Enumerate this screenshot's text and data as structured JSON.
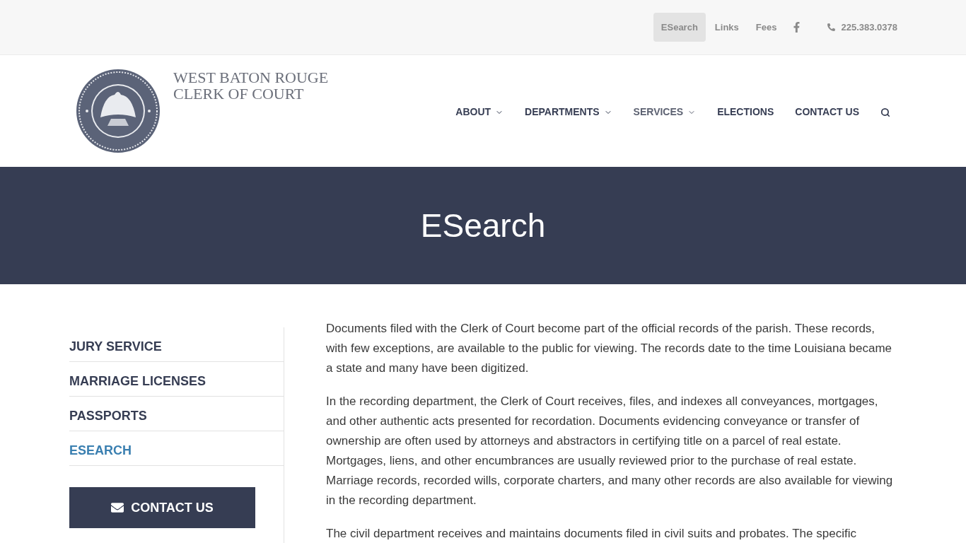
{
  "top_bar": {
    "links": [
      {
        "label": "ESearch",
        "selected": true
      },
      {
        "label": "Links",
        "selected": false
      },
      {
        "label": "Fees",
        "selected": false
      }
    ],
    "phone": "225.383.0378"
  },
  "header": {
    "title_lines": [
      "WEST BATON ROUGE",
      "CLERK OF COURT"
    ],
    "nav": [
      {
        "label": "ABOUT",
        "dropdown": true,
        "selected": false
      },
      {
        "label": "DEPARTMENTS",
        "dropdown": true,
        "selected": false
      },
      {
        "label": "SERVICES",
        "dropdown": true,
        "selected": true
      },
      {
        "label": "ELECTIONS",
        "dropdown": false,
        "selected": false
      },
      {
        "label": "CONTACT US",
        "dropdown": false,
        "selected": false
      }
    ]
  },
  "banner": {
    "title": "ESearch"
  },
  "sidebar": {
    "items": [
      {
        "label": "JURY SERVICE",
        "selected": false
      },
      {
        "label": "MARRIAGE LICENSES",
        "selected": false
      },
      {
        "label": "PASSPORTS",
        "selected": false
      },
      {
        "label": "ESEARCH",
        "selected": true
      }
    ],
    "contact_button": "CONTACT US"
  },
  "content": {
    "paragraphs": [
      "Documents filed with the Clerk of Court become part of the official records of the parish. These records, with few exceptions, are available to the public for viewing. The records date to the time Louisiana became a state and many have been digitized.",
      "In the recording department, the Clerk of Court receives, files, and indexes all conveyances, mortgages, and other authentic acts presented for recordation. Documents evidencing conveyance or transfer of ownership are often used by attorneys and abstractors in certifying title on a parcel of real estate. Mortgages, liens, and other encumbrances are usually reviewed prior to the purchase of real estate. Marriage records, recorded wills, corporate charters, and many other records are also available for viewing in the recording department.",
      "The civil department receives and maintains documents filed in civil suits and probates. The specific"
    ]
  }
}
